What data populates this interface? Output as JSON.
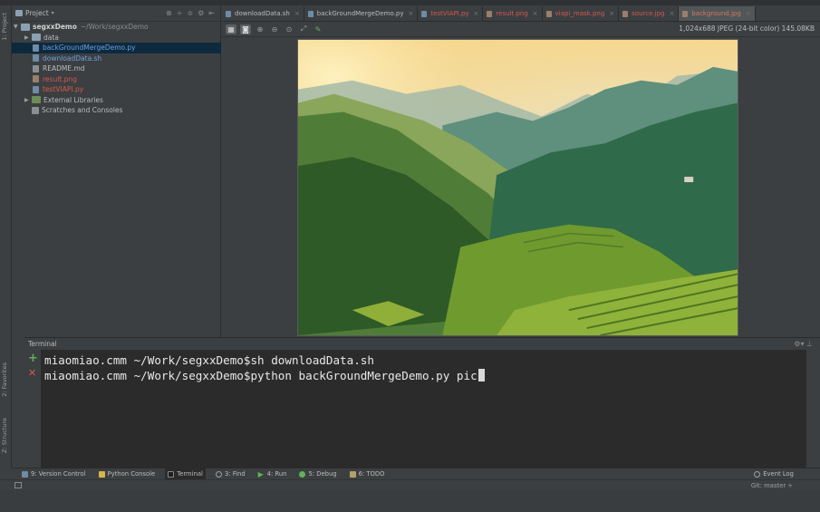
{
  "project": {
    "title": "Project",
    "root_name": "segxxDemo",
    "root_path": "~/Work/segxxDemo",
    "items": [
      {
        "label": "data",
        "kind": "folder",
        "color": "normal"
      },
      {
        "label": "backGroundMergeDemo.py",
        "kind": "file",
        "color": "blue",
        "selected": true
      },
      {
        "label": "downloadData.sh",
        "kind": "file",
        "color": "blue"
      },
      {
        "label": "README.md",
        "kind": "file",
        "color": "normal"
      },
      {
        "label": "result.png",
        "kind": "file",
        "color": "red"
      },
      {
        "label": "testVIAPI.py",
        "kind": "file",
        "color": "red"
      }
    ],
    "external_libraries": "External Libraries",
    "scratches": "Scratches and Consoles"
  },
  "side_tabs": {
    "project": "1: Project",
    "favorites": "2: Favorites",
    "structure": "Z: Structure"
  },
  "editor_tabs": [
    {
      "label": "downloadData.sh",
      "active": false
    },
    {
      "label": "backGroundMergeDemo.py",
      "active": false
    },
    {
      "label": "testVIAPI.py",
      "active": false
    },
    {
      "label": "result.png",
      "active": false
    },
    {
      "label": "viapi_mask.png",
      "active": false
    },
    {
      "label": "source.jpg",
      "active": false
    },
    {
      "label": "background.jpg",
      "active": true
    }
  ],
  "image_viewer": {
    "info": "1,024x688 JPEG (24-bit color) 145.08KB"
  },
  "terminal": {
    "title": "Terminal",
    "line1": "miaomiao.cmm ~/Work/segxxDemo$sh downloadData.sh",
    "line2": "miaomiao.cmm ~/Work/segxxDemo$python backGroundMergeDemo.py pic"
  },
  "tool_windows": [
    {
      "key": "9",
      "label": "9: Version Control",
      "icon": "version-control-icon"
    },
    {
      "key": "",
      "label": "Python Console",
      "icon": "python-console-icon"
    },
    {
      "key": "",
      "label": "Terminal",
      "icon": "terminal-icon",
      "active": true
    },
    {
      "key": "3",
      "label": "3: Find",
      "icon": "find-icon"
    },
    {
      "key": "4",
      "label": "4: Run",
      "icon": "run-icon"
    },
    {
      "key": "5",
      "label": "5: Debug",
      "icon": "debug-icon"
    },
    {
      "key": "6",
      "label": "6: TODO",
      "icon": "todo-icon"
    }
  ],
  "event_log": "Event Log",
  "status": {
    "git_branch": "Git: master ÷"
  },
  "colors": {
    "accent_red": "#d4594d",
    "accent_blue": "#6f9fe0",
    "selection": "#0d293e",
    "active_tab_text": "#d37a58"
  }
}
